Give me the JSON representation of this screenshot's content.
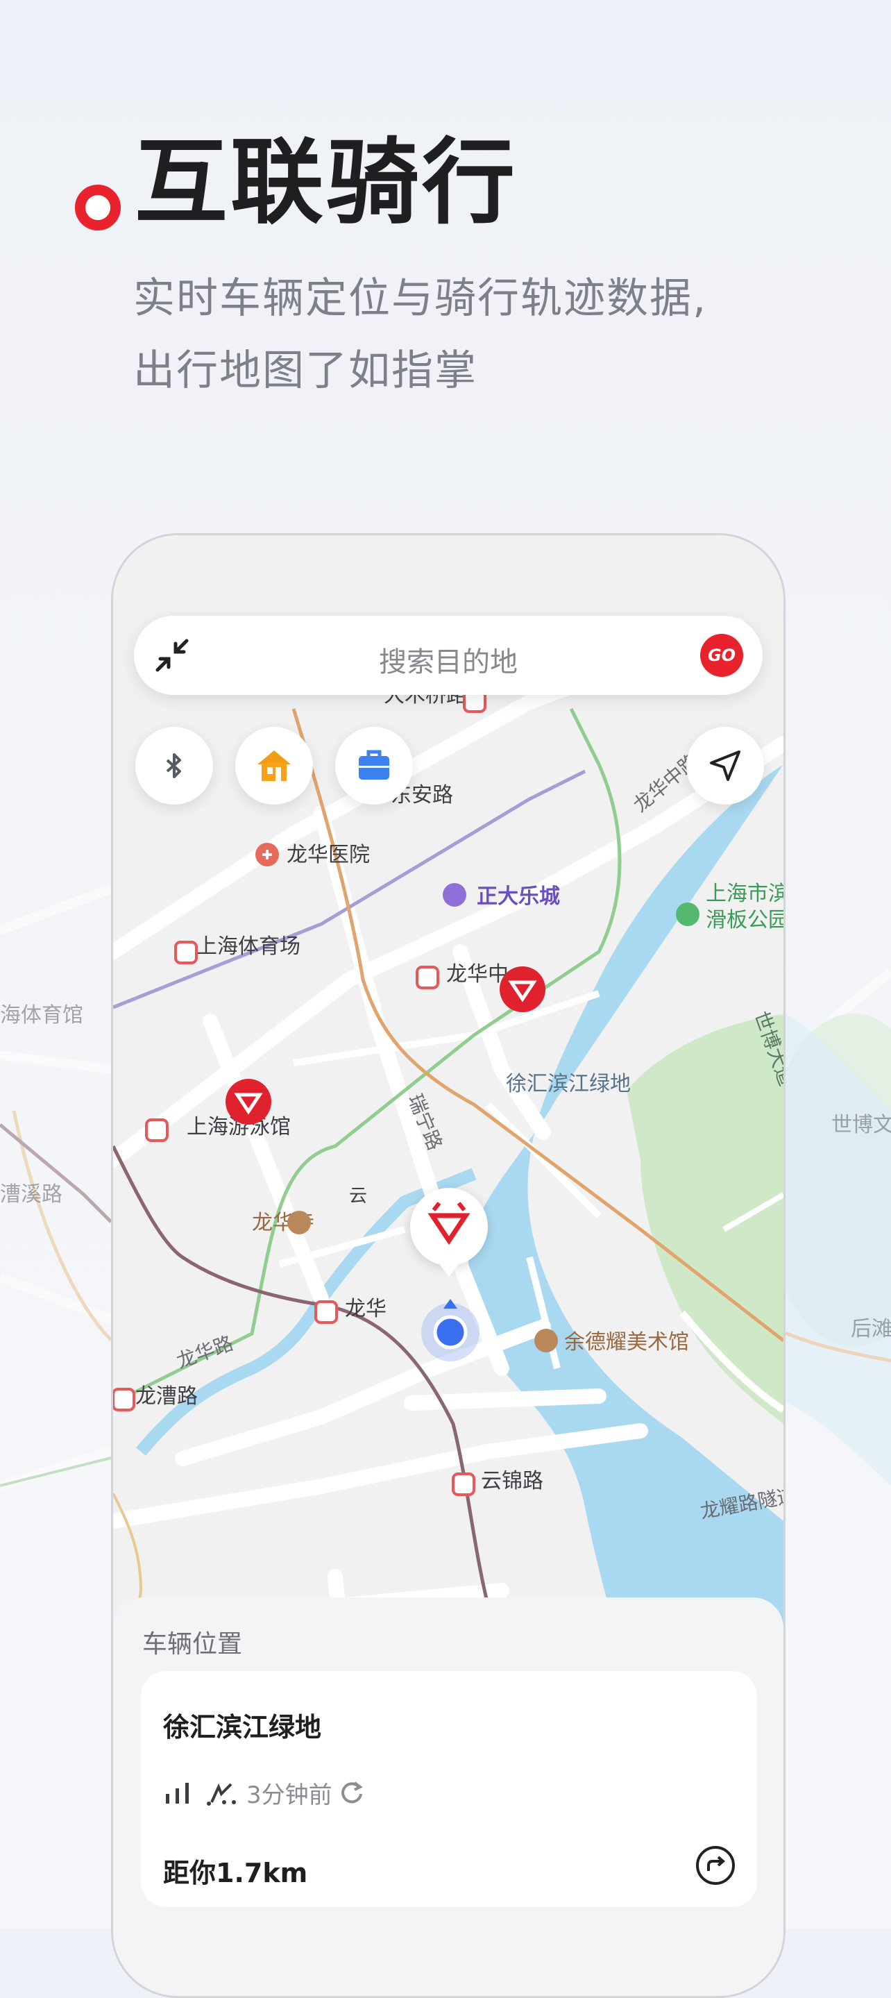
{
  "header": {
    "title": "互联骑行",
    "subtitle_line1": "实时车辆定位与骑行轨迹数据,",
    "subtitle_line2": "出行地图了如指掌"
  },
  "search": {
    "placeholder": "搜索目的地",
    "go_label": "GO"
  },
  "quick_buttons": {
    "bluetooth": "bluetooth-icon",
    "home": "home-icon",
    "work": "briefcase-icon",
    "locate": "navigation-arrow-icon"
  },
  "map_labels": {
    "damuqiao": "大木桥路",
    "dongan": "东安路",
    "longhua_hospital": "龙华医院",
    "zhengda": "正大乐城",
    "longhua_middle_rd": "龙华中路",
    "binjiang_park": "上海市滨江",
    "binjiang_park2": "滑板公园",
    "sh_stadium": "上海体育场",
    "stadium_west": "海体育馆",
    "longhua_zhong": "龙华中",
    "xuhui_greenland": "徐汇滨江绿地",
    "shibo_ave": "世博大道",
    "shibo_right": "世博文",
    "ruining": "瑞宁路",
    "swim": "上海游泳馆",
    "caoxi": "漕溪路",
    "yun": "云",
    "longhua_temple": "龙华寺",
    "longhua_station": "龙华",
    "longhua_rd": "龙华路",
    "houtan": "后滩",
    "yude": "余德耀美术馆",
    "longcao": "龙漕路",
    "yunjin": "云锦路",
    "longyao_tunnel": "龙耀路隧道"
  },
  "vehicle_panel": {
    "title": "车辆位置",
    "location_name": "徐汇滨江绿地",
    "updated": "3分钟前",
    "distance": "距你1.7km"
  },
  "colors": {
    "brand_red": "#e8232e",
    "river_blue": "#a9d9f0",
    "park_green": "#cfe9c8",
    "user_blue": "#3a6ff0"
  }
}
